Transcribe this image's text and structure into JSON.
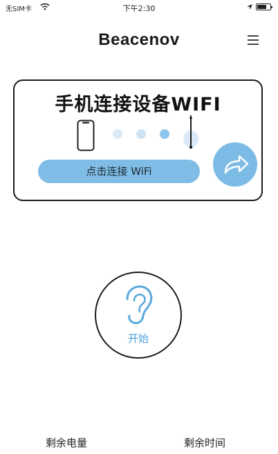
{
  "status_bar": {
    "carrier": "无SIM卡",
    "time": "下午2:30",
    "icons": [
      "wifi-icon",
      "location-icon",
      "battery-icon"
    ]
  },
  "header": {
    "title": "Beacenov",
    "menu_icon": "hamburger-menu-icon"
  },
  "connect_card": {
    "title": "手机连接设备WIFI",
    "connect_button_label": "点击连接 WiFi",
    "icons": [
      "phone-icon",
      "progress-dots",
      "device-icon",
      "share-arrow-icon"
    ],
    "colors": {
      "accent": "#7fbde6",
      "dot_light": "#dbeaf6",
      "dot_mid": "#cfe2f2",
      "dot_active": "#8fc4ea"
    }
  },
  "start": {
    "label": "开始",
    "icon": "ear-icon",
    "label_color": "#4a9fd8"
  },
  "footer": {
    "battery_label": "剩余电量",
    "time_label": "剩余时间"
  }
}
